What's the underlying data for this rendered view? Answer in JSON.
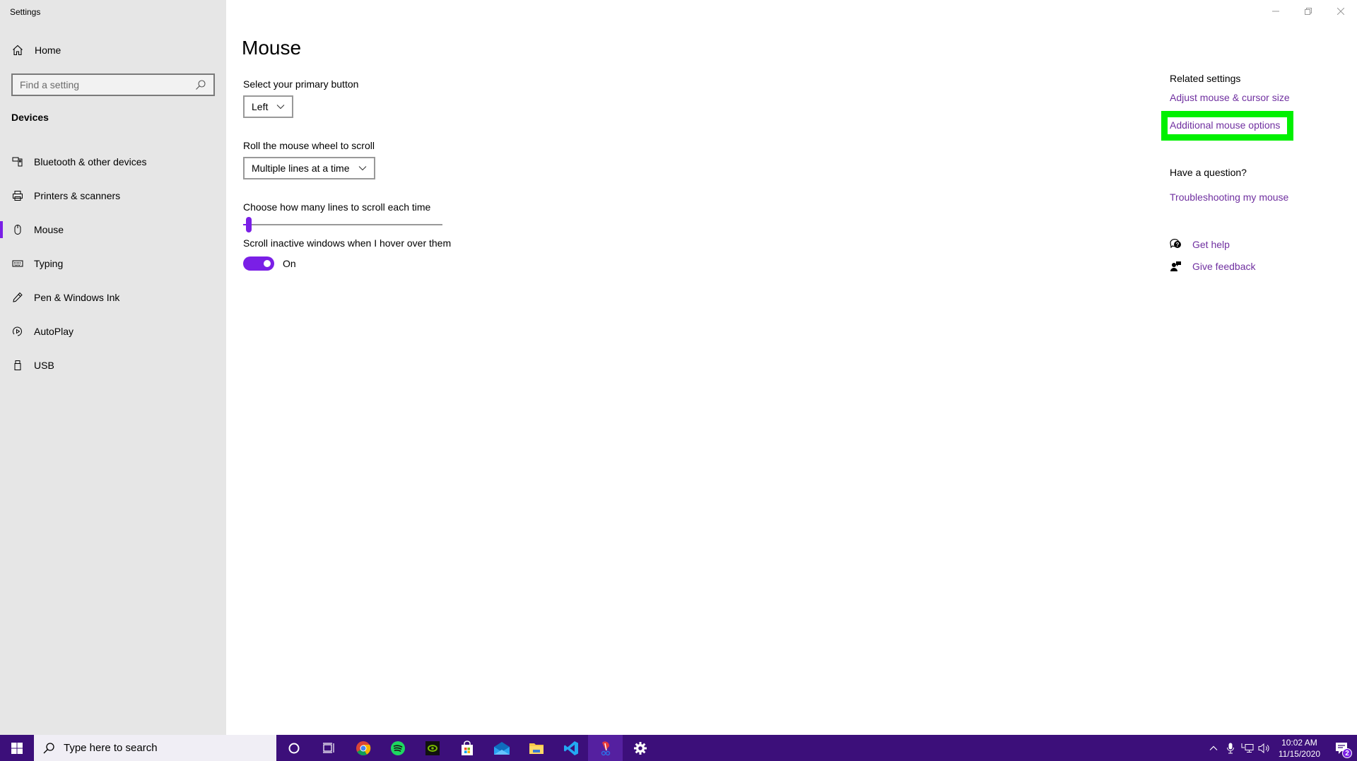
{
  "window": {
    "title": "Settings",
    "controls": {
      "minimize": "minimize",
      "restore": "restore",
      "close": "close"
    }
  },
  "sidebar": {
    "home_label": "Home",
    "search_placeholder": "Find a setting",
    "section_title": "Devices",
    "items": [
      {
        "label": "Bluetooth & other devices",
        "icon": "bluetooth-devices-icon",
        "active": false
      },
      {
        "label": "Printers & scanners",
        "icon": "printer-icon",
        "active": false
      },
      {
        "label": "Mouse",
        "icon": "mouse-icon",
        "active": true
      },
      {
        "label": "Typing",
        "icon": "keyboard-icon",
        "active": false
      },
      {
        "label": "Pen & Windows Ink",
        "icon": "pen-icon",
        "active": false
      },
      {
        "label": "AutoPlay",
        "icon": "autoplay-icon",
        "active": false
      },
      {
        "label": "USB",
        "icon": "usb-icon",
        "active": false
      }
    ]
  },
  "main": {
    "title": "Mouse",
    "primary_button": {
      "label": "Select your primary button",
      "value": "Left"
    },
    "wheel_scroll": {
      "label": "Roll the mouse wheel to scroll",
      "value": "Multiple lines at a time"
    },
    "lines_slider": {
      "label": "Choose how many lines to scroll each time",
      "value_fraction": 0.03
    },
    "inactive_scroll": {
      "label": "Scroll inactive windows when I hover over them",
      "state": "On",
      "enabled": true
    }
  },
  "related": {
    "heading": "Related settings",
    "links": [
      "Adjust mouse & cursor size",
      "Additional mouse options"
    ],
    "question_heading": "Have a question?",
    "question_link": "Troubleshooting my mouse",
    "get_help": "Get help",
    "give_feedback": "Give feedback"
  },
  "colors": {
    "accent": "#7a1fe6",
    "link": "#7030a0",
    "highlight": "#00f000",
    "taskbar": "#3c0f7a",
    "sidebar_bg": "#e6e6e6"
  },
  "taskbar": {
    "search_placeholder": "Type here to search",
    "apps": [
      "cortana",
      "task-view",
      "chrome",
      "spotify",
      "nvidia",
      "store",
      "mail",
      "file-explorer",
      "vscode",
      "snip-sketch",
      "settings"
    ],
    "time": "10:02 AM",
    "date": "11/15/2020",
    "notification_count": "2"
  }
}
